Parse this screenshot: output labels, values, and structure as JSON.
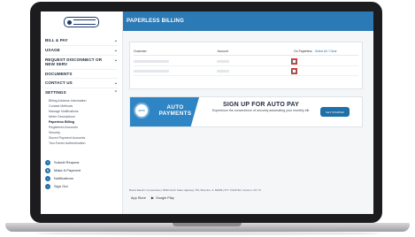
{
  "page": {
    "title": "PAPERLESS BILLING"
  },
  "logo": {
    "text": "Energy provider logo"
  },
  "nav": {
    "items": [
      {
        "label": "BILL & PAY",
        "chevron": "⌄"
      },
      {
        "label": "USAGE",
        "chevron": "⌄"
      },
      {
        "label": "REQUEST DISCONNECT OR NEW SERV",
        "chevron": "⌄"
      },
      {
        "label": "DOCUMENTS",
        "chevron": ""
      },
      {
        "label": "CONTACT US",
        "chevron": "⌄"
      },
      {
        "label": "SETTINGS",
        "chevron": "⌃"
      }
    ],
    "settings_sub": [
      "Billing Address Information",
      "Contact Methods",
      "Manage Notifications",
      "Meter Descriptions",
      "Paperless Billing",
      "Registered Accounts",
      "Security",
      "Stored Payment Accounts",
      "Two-Factor Authentication"
    ]
  },
  "quick_links": [
    {
      "label": "Submit Request",
      "icon": "request-icon"
    },
    {
      "label": "Make A Payment",
      "icon": "payment-icon"
    },
    {
      "label": "Notifications",
      "icon": "bell-icon"
    },
    {
      "label": "Sign Out",
      "icon": "sign-out-icon"
    }
  ],
  "table": {
    "headers": {
      "customer": "Customer",
      "account": "Account",
      "paperless": "Go Paperless",
      "select_all": "Select All / Clear"
    }
  },
  "banner": {
    "auto": "AUTO",
    "payments": "PAYMENTS",
    "badge": "AUTO",
    "headline": "SIGN UP FOR AUTO PAY",
    "sub": "Experience the convenience of securely automating your monthly bill.",
    "button": "GET STARTED"
  },
  "footer": {
    "line": "Brand Electric Cooperative  |  8000 North State Highway 735, Brandon, IL 82898  |  877.739.8784  |  Version: 20.7.8",
    "app_store": "App Store",
    "google_play": "Google Play"
  },
  "colors": {
    "topbar": "#2b79b5",
    "banner": "#2f84c3",
    "highlight": "#d0312d"
  }
}
